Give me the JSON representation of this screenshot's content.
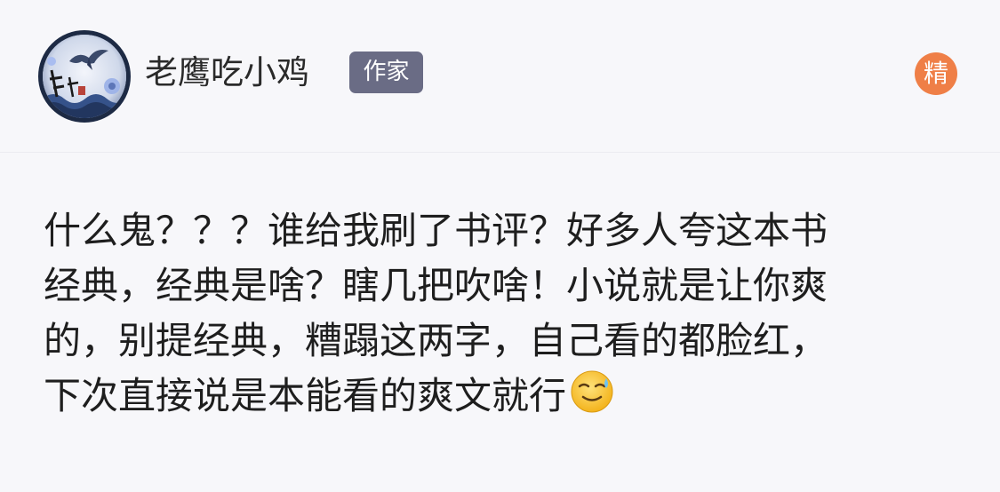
{
  "author": {
    "name": "老鹰吃小鸡",
    "badge": "作家",
    "avatar_icon": "bird-illustration-avatar"
  },
  "featured_badge": {
    "label": "精",
    "color": "#ef7f47"
  },
  "post": {
    "lines": [
      "什么鬼？？？谁给我刷了书评？好多人夸这本书",
      "经典，经典是啥？瞎几把吹啥！小说就是让你爽",
      "的，别提经典，糟蹋这两字，自己看的都脸红，",
      "下次直接说是本能看的爽文就行"
    ],
    "emoji": "sweat-smile-emoji"
  },
  "colors": {
    "background": "#f7f7fa",
    "badge_bg": "#6a6c85",
    "text": "#1e1e1e"
  }
}
